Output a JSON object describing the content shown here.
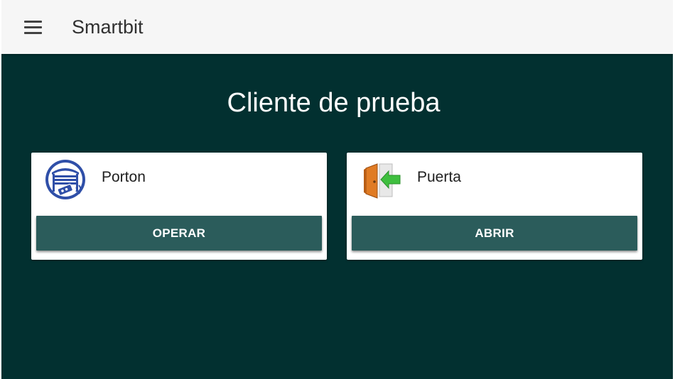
{
  "appbar": {
    "title": "Smartbit",
    "menu_icon": "hamburger-menu-icon"
  },
  "main": {
    "title": "Cliente de prueba",
    "devices": [
      {
        "name": "Porton",
        "icon": "garage-gate-remote-icon",
        "action_label": "OPERAR"
      },
      {
        "name": "Puerta",
        "icon": "door-enter-arrow-icon",
        "action_label": "ABRIR"
      }
    ]
  },
  "colors": {
    "appbar_background": "#f6f6f6",
    "page_background": "#023030",
    "button_background": "#2b5c5b",
    "card_background": "#ffffff"
  }
}
